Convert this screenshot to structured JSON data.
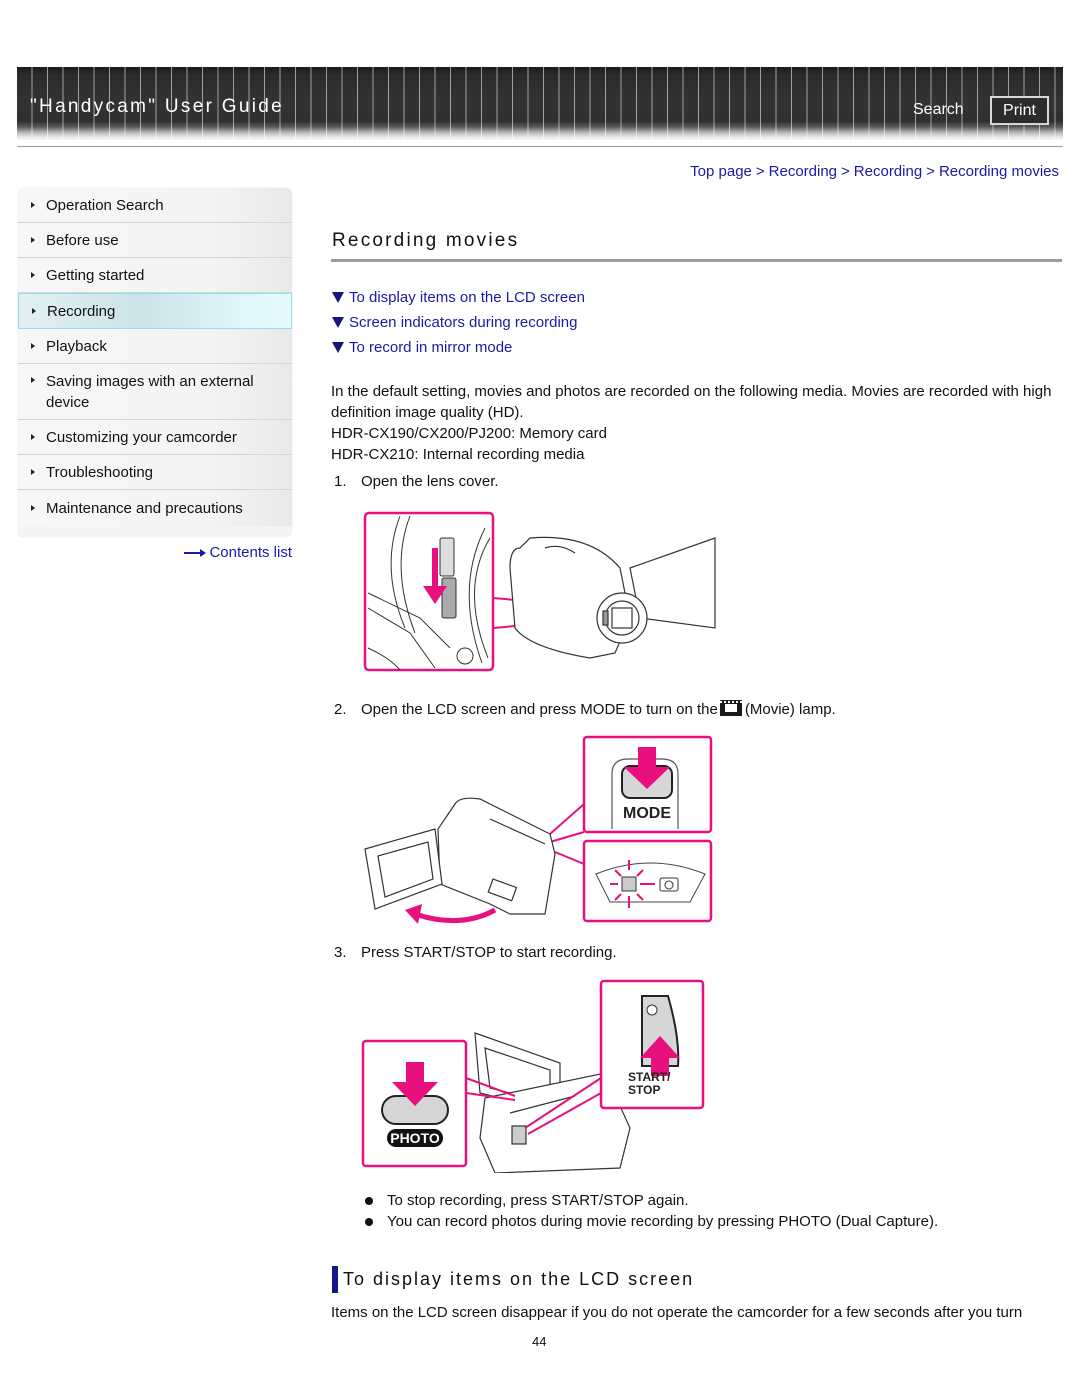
{
  "header": {
    "title": "\"Handycam\" User Guide",
    "search_label": "Search",
    "print_label": "Print"
  },
  "breadcrumb": [
    {
      "label": "Top page"
    },
    {
      "label": "Recording"
    },
    {
      "label": "Recording"
    },
    {
      "label": "Recording movies"
    }
  ],
  "breadcrumb_separator": ">",
  "sidebar": {
    "items": [
      {
        "label": "Operation Search",
        "active": false
      },
      {
        "label": "Before use",
        "active": false
      },
      {
        "label": "Getting started",
        "active": false
      },
      {
        "label": "Recording",
        "active": true
      },
      {
        "label": "Playback",
        "active": false
      },
      {
        "label": "Saving images with an external device",
        "active": false
      },
      {
        "label": "Customizing your camcorder",
        "active": false
      },
      {
        "label": "Troubleshooting",
        "active": false
      },
      {
        "label": "Maintenance and precautions",
        "active": false
      }
    ],
    "contents_list_label": "Contents list"
  },
  "main": {
    "title": "Recording movies",
    "toc": [
      {
        "label": "To display items on the LCD screen"
      },
      {
        "label": "Screen indicators during recording"
      },
      {
        "label": "To record in mirror mode"
      }
    ],
    "intro": {
      "line1": "In the default setting, movies and photos are recorded on the following media. Movies are recorded with high definition image quality (HD).",
      "line2": "HDR-CX190/CX200/PJ200: Memory card",
      "line3": "HDR-CX210: Internal recording media"
    },
    "steps": [
      {
        "num": "1.",
        "text": "Open the lens cover."
      },
      {
        "num": "2.",
        "text_before": "Open the LCD screen and press MODE to turn on the",
        "icon": "movie-icon",
        "text_after": "(Movie) lamp."
      },
      {
        "num": "3.",
        "text": "Press START/STOP to start recording."
      }
    ],
    "figure_labels": {
      "mode": "MODE",
      "start_stop_line1": "START/",
      "start_stop_line2": "STOP",
      "photo": "PHOTO"
    },
    "bullets": [
      "To stop recording, press START/STOP again.",
      "You can record photos during movie recording by pressing PHOTO (Dual Capture)."
    ],
    "section": {
      "title": "To display items on the LCD screen",
      "text": "Items on the LCD screen disappear if you do not operate the camcorder for a few seconds after you turn"
    }
  },
  "colors": {
    "link": "#1a1aa6",
    "accent_magenta": "#e8107f",
    "section_bar": "#15158f",
    "header_bg": "#333333"
  },
  "footer": {
    "page_number": "44"
  }
}
